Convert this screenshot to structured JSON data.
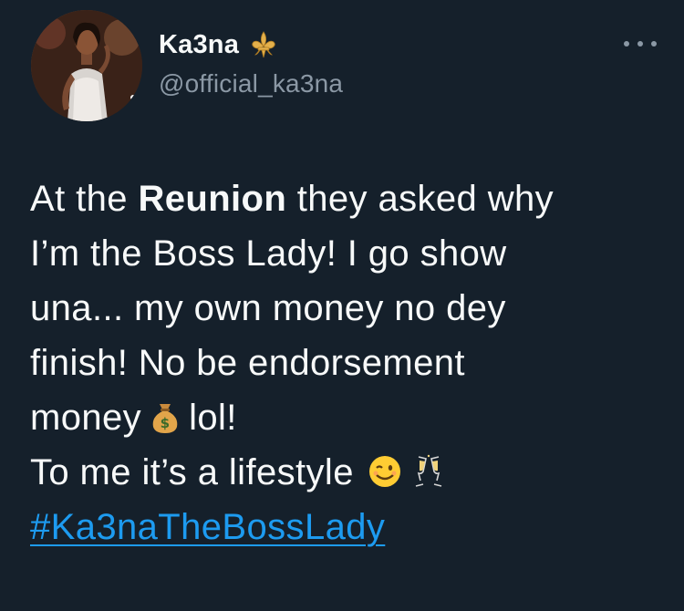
{
  "author": {
    "display_name": "Ka3na",
    "handle": "@official_ka3na",
    "badge_icon": "fleur-de-lis-icon",
    "avatar_icon": "profile-photo"
  },
  "menu": {
    "icon": "more-options-icon"
  },
  "tweet": {
    "line1_pre": "At the ",
    "line1_bold": "Reunion",
    "line1_post": " they asked why",
    "line2": "I’m the Boss Lady! I go show",
    "line3": "una... my own money no dey",
    "line4": "finish! No be endorsement",
    "line5_pre": "money",
    "line5_emoji": "money-bag-icon",
    "line5_post": "lol!",
    "line6_pre": "To me it’s a lifestyle",
    "line6_emoji1": "winking-face-icon",
    "line6_emoji2": "clinking-glasses-icon",
    "hashtag": "#Ka3naTheBossLady"
  },
  "colors": {
    "background": "#15202b",
    "text": "#f7f9f9",
    "secondary_text": "#8b98a5",
    "link": "#1d9bf0"
  }
}
